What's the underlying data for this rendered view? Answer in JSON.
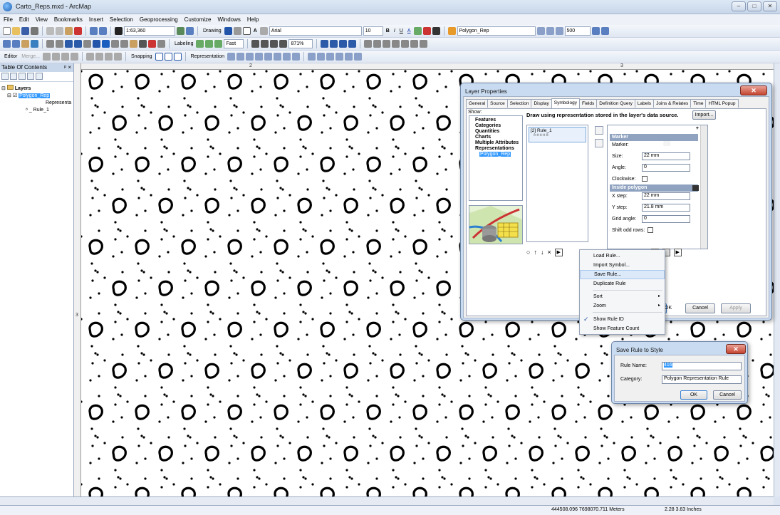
{
  "window": {
    "title": "Carto_Reps.mxd - ArcMap",
    "min": "–",
    "max": "□",
    "close": "✕"
  },
  "menubar": [
    "File",
    "Edit",
    "View",
    "Bookmarks",
    "Insert",
    "Selection",
    "Geoprocessing",
    "Customize",
    "Windows",
    "Help"
  ],
  "toolbar": {
    "scale": "1:63,360",
    "drawing": "Drawing",
    "font": "Arial",
    "font_size": "10",
    "bold": "B",
    "italic": "I",
    "underline": "U",
    "font_color": "A",
    "layer": "Polygon_Rep",
    "count": "500",
    "labeling": "Labeling",
    "fast": "Fast",
    "zoom": "871%",
    "editor": "Editor",
    "merge": "Merge...",
    "snapping": "Snapping",
    "representation": "Representation"
  },
  "toc": {
    "title": "Table Of Contents",
    "pin": " ᵖ ×",
    "layers": "Layers",
    "layer_name": "Polygon_Rep",
    "representation": "Representa",
    "rule": " ⁸ _ Rule_1",
    "expand": "⊟",
    "checked": "☑"
  },
  "ruler": {
    "t2": "2",
    "t3": "3",
    "l3": "3"
  },
  "status": {
    "coords": "444508.096 7698070.711 Meters",
    "inches": "2.28 3.63 Inches"
  },
  "layer_props": {
    "title": "Layer Properties",
    "close": "✕",
    "tabs": [
      "General",
      "Source",
      "Selection",
      "Display",
      "Symbology",
      "Fields",
      "Definition Query",
      "Labels",
      "Joins & Relates",
      "Time",
      "HTML Popup"
    ],
    "show_label": "Show:",
    "show_items": [
      "Features",
      "Categories",
      "Quantities",
      "Charts",
      "Multiple Attributes",
      "Representations"
    ],
    "show_selected": "Polygon_Rep",
    "description": "Draw using representation stored in the layer's data source.",
    "import_btn": "Import...",
    "rule_item": "[2] Rule_1",
    "rule_glyph": "ô·ö·ò·ó·ō·",
    "marker_header": "Marker",
    "marker_label": "Marker:",
    "marker_glyph": "░░",
    "size_label": "Size:",
    "size_val": "22 mm",
    "angle_label": "Angle:",
    "angle_val": "0",
    "clockwise_label": "Clockwise:",
    "inside_header": "Inside polygon",
    "xstep_label": "X step:",
    "xstep_val": "22 mm",
    "ystep_label": "Y step:",
    "ystep_val": "21.8 mm",
    "gridangle_label": "Grid angle:",
    "gridangle_val": "0",
    "shiftodd_label": "Shift odd rows:",
    "plus": "+",
    "ok_btn": "OK",
    "cancel_btn": "Cancel",
    "apply_btn": "Apply"
  },
  "context_menu": {
    "items": [
      "Load Rule...",
      "Import Symbol...",
      "Save Rule...",
      "Duplicate Rule",
      "Sort",
      "Zoom",
      "Show Rule ID",
      "Show Feature Count"
    ],
    "arrow": "▸",
    "check": "✓"
  },
  "save_dialog": {
    "title": "Save Rule to Style",
    "close": "✕",
    "rule_name_label": "Rule Name:",
    "rule_name_val": "416",
    "category_label": "Category:",
    "category_val": "Polygon Representation Rule",
    "ok": "OK",
    "cancel": "Cancel"
  },
  "colors": {
    "accent": "#3399ff",
    "dialog_frame": "#c9dbf1",
    "close_red": "#c5442f"
  }
}
